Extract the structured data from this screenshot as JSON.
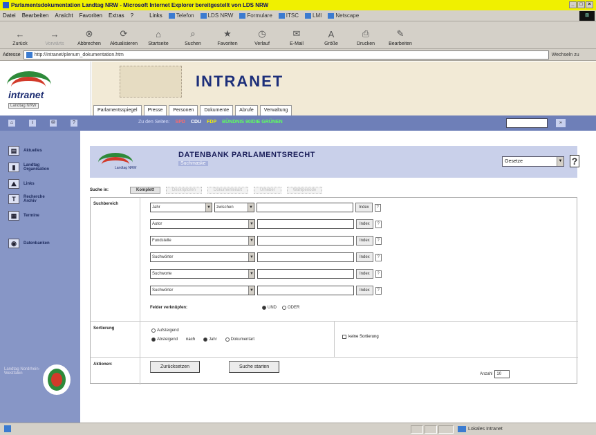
{
  "window": {
    "title": "Parlamentsdokumentation Landtag NRW - Microsoft Internet Explorer bereitgestellt von LDS NRW",
    "controls": [
      "_",
      "□",
      "×"
    ]
  },
  "menubar": {
    "items": [
      "Datei",
      "Bearbeiten",
      "Ansicht",
      "Favoriten",
      "Extras",
      "?"
    ],
    "links_label": "Links",
    "links": [
      "Telefon",
      "LDS NRW",
      "Formulare",
      "ITSC",
      "LMI",
      "Netscape"
    ]
  },
  "toolbar": {
    "buttons": [
      {
        "label": "Zurück",
        "icon": "back-arrow-icon",
        "glyph": "←",
        "enabled": true
      },
      {
        "label": "Vorwärts",
        "icon": "forward-arrow-icon",
        "glyph": "→",
        "enabled": false
      },
      {
        "label": "Abbrechen",
        "icon": "stop-icon",
        "glyph": "⊗",
        "enabled": true
      },
      {
        "label": "Aktualisieren",
        "icon": "refresh-icon",
        "glyph": "⟳",
        "enabled": true
      },
      {
        "label": "Startseite",
        "icon": "home-icon",
        "glyph": "⌂",
        "enabled": true
      },
      {
        "label": "Suchen",
        "icon": "search-icon",
        "glyph": "⌕",
        "enabled": true
      },
      {
        "label": "Favoriten",
        "icon": "favorites-icon",
        "glyph": "★",
        "enabled": true
      },
      {
        "label": "Verlauf",
        "icon": "history-icon",
        "glyph": "◷",
        "enabled": true
      },
      {
        "label": "E-Mail",
        "icon": "mail-icon",
        "glyph": "✉",
        "enabled": true
      },
      {
        "label": "Größe",
        "icon": "font-size-icon",
        "glyph": "A",
        "enabled": true
      },
      {
        "label": "Drucken",
        "icon": "print-icon",
        "glyph": "⎙",
        "enabled": true
      },
      {
        "label": "Bearbeiten",
        "icon": "edit-icon",
        "glyph": "✎",
        "enabled": true
      }
    ]
  },
  "address": {
    "label": "Adresse",
    "url": "http://intranet/plenum_dokumentation.htm",
    "go_label": "Wechseln zu"
  },
  "header": {
    "logo_text": "intranet",
    "logo_sub": "Landtag NRW",
    "banner_title": "INTRANET",
    "nav_tabs": [
      "Parlamentsspiegel",
      "Presse",
      "Personen",
      "Dokumente",
      "Abrufe",
      "Verwaltung"
    ]
  },
  "strip": {
    "icons": [
      "home-icon",
      "info-icon",
      "mail-icon",
      "help-icon"
    ],
    "sites_label": "Zu den Seiten:",
    "sites": [
      "SPD",
      "CDU",
      "FDP",
      "BÜNDNIS 90/DIE GRÜNEN"
    ]
  },
  "sidebar": {
    "items": [
      {
        "label": "Aktuelles",
        "icon": "newspaper-icon"
      },
      {
        "label": "Landtag Organisation",
        "icon": "building-icon"
      },
      {
        "label": "Links",
        "icon": "link-icon"
      },
      {
        "label": "Recherche Archiv",
        "icon": "archive-icon"
      },
      {
        "label": "Termine",
        "icon": "calendar-icon"
      },
      {
        "label": "Datenbanken",
        "icon": "database-icon"
      }
    ],
    "footer_text": "Landtag Nordrhein-Westfalen"
  },
  "db": {
    "title": "DATENBANK PARLAMENTSRECHT",
    "subtitle": "Suchmaske",
    "select_value": "Gesetze",
    "help": "?"
  },
  "search_tabs": {
    "label": "Suche in:",
    "tabs": [
      "Komplett",
      "Deskriptoren",
      "Dokumentenart",
      "Urheber",
      "Wahlperiode"
    ],
    "active_index": 0
  },
  "criteria": {
    "section_label": "Suchbereich",
    "rows": [
      {
        "field": "Jahr",
        "operator": "zwischen",
        "value": "",
        "button": "Index",
        "help": "?"
      },
      {
        "field": "Autor",
        "operator": "",
        "value": "",
        "button": "Index",
        "help": "?"
      },
      {
        "field": "Fundstelle",
        "operator": "",
        "value": "",
        "button": "Index",
        "help": "?"
      },
      {
        "field": "Suchwörter",
        "operator": "",
        "value": "",
        "button": "Index",
        "help": "?"
      },
      {
        "field": "Suchworte",
        "operator": "",
        "value": "",
        "button": "Index",
        "help": "?"
      },
      {
        "field": "Suchwörter",
        "operator": "",
        "value": "",
        "button": "Index",
        "help": "?"
      }
    ],
    "link_label": "Felder verknüpfen:",
    "link_options": [
      "UND",
      "ODER"
    ],
    "link_selected": "UND"
  },
  "sorting": {
    "label": "Sortierung",
    "opt_asc": "Aufsteigend",
    "opt_desc": "Absteigend",
    "asc_selected": false,
    "by_label": "nach",
    "by_options": [
      "Jahr",
      "Dokumentart"
    ],
    "by_selected": "Jahr",
    "no_sort_label": "keine Sortierung",
    "no_sort_checked": false
  },
  "actions": {
    "label": "Aktionen:",
    "buttons": [
      "Zurücksetzen",
      "Suche starten"
    ]
  },
  "results": {
    "per_page_label": "Anzahl",
    "per_page_value": "10"
  },
  "status": {
    "text": "",
    "zone": "Lokales Intranet"
  }
}
